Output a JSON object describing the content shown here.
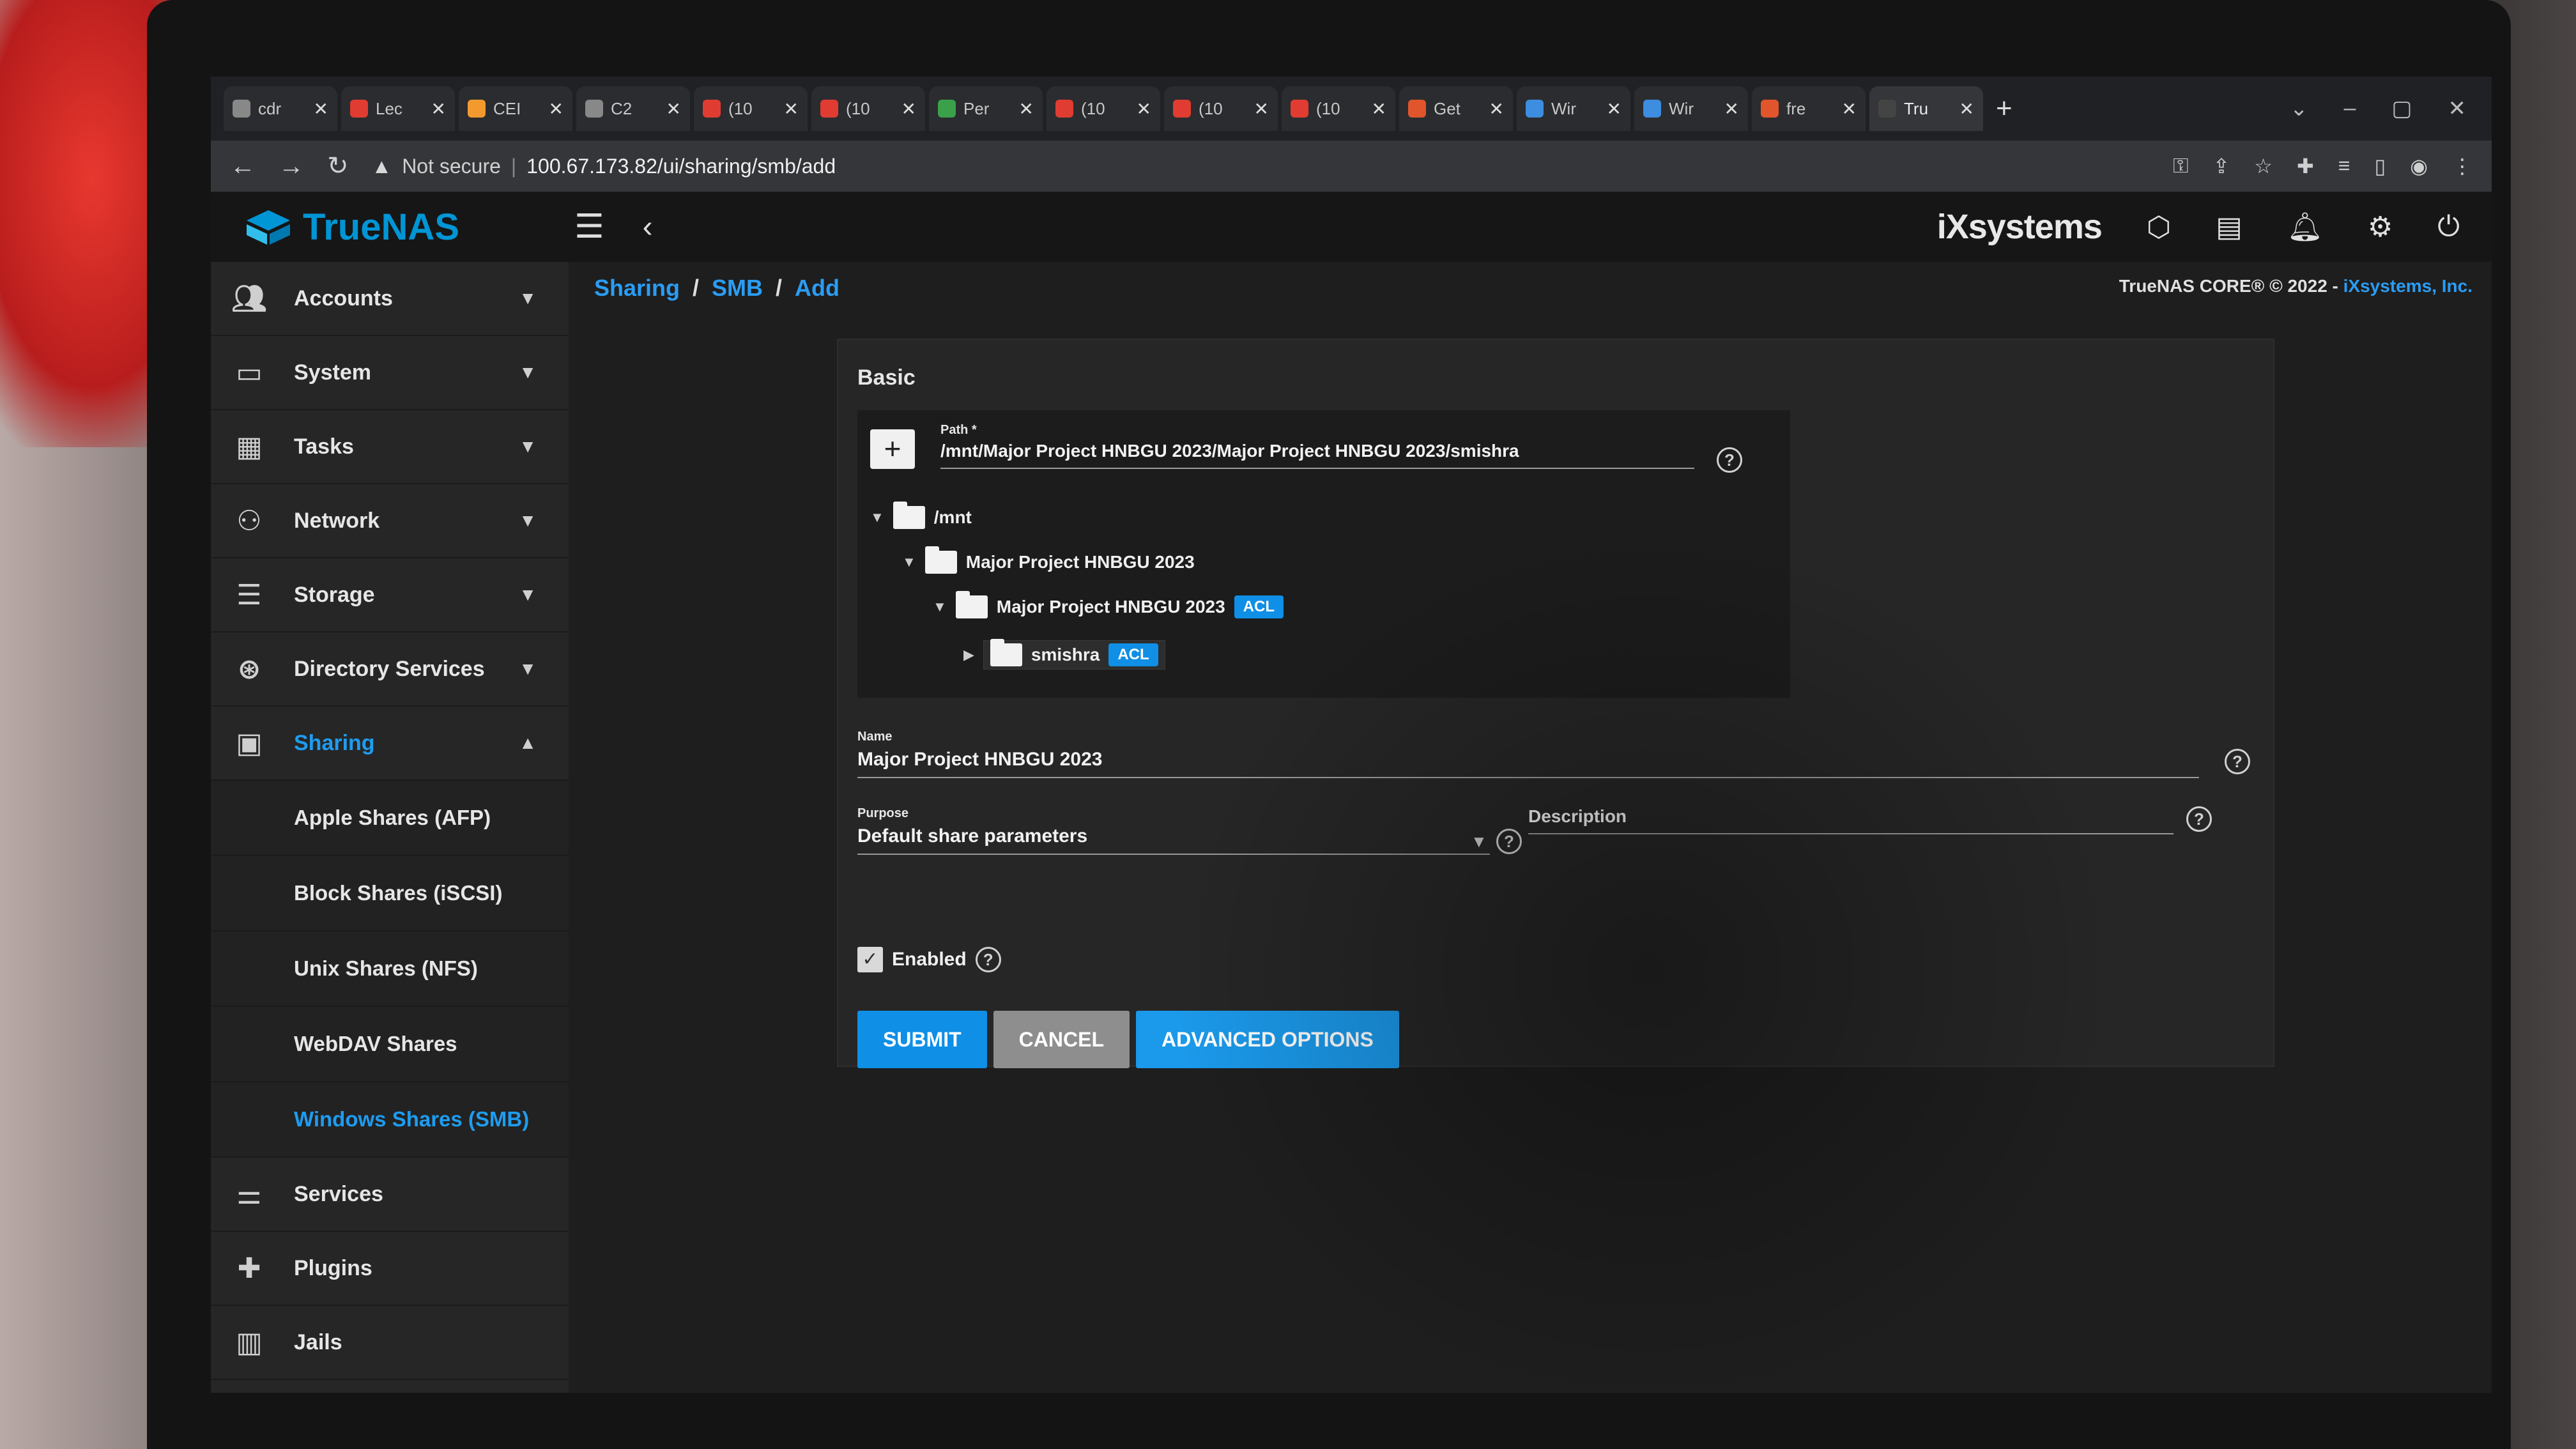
{
  "browser": {
    "tabs": [
      {
        "label": "cdr",
        "color": "#888888"
      },
      {
        "label": "Lec",
        "color": "#e03c31"
      },
      {
        "label": "CEI",
        "color": "#f29a2e"
      },
      {
        "label": "C2",
        "color": "#888888"
      },
      {
        "label": "(10",
        "color": "#e03c31"
      },
      {
        "label": "(10",
        "color": "#e03c31"
      },
      {
        "label": "Per",
        "color": "#3aa14a"
      },
      {
        "label": "(10",
        "color": "#e03c31"
      },
      {
        "label": "(10",
        "color": "#e03c31"
      },
      {
        "label": "(10",
        "color": "#e03c31"
      },
      {
        "label": "Get",
        "color": "#e0552b"
      },
      {
        "label": "Wir",
        "color": "#3d8de0"
      },
      {
        "label": "Wir",
        "color": "#3d8de0"
      },
      {
        "label": "fre",
        "color": "#e0552b"
      },
      {
        "label": "Tru",
        "color": "#444444"
      }
    ],
    "security": "Not secure",
    "url": "100.67.173.82/ui/sharing/smb/add"
  },
  "app": {
    "brand": "TrueNAS",
    "vendor": "iXsystems",
    "copyright_prefix": "TrueNAS CORE® © 2022 - ",
    "copyright_link": "iXsystems, Inc."
  },
  "sidebar": {
    "items": [
      {
        "label": "Accounts",
        "icon": "accounts-icon"
      },
      {
        "label": "System",
        "icon": "system-icon"
      },
      {
        "label": "Tasks",
        "icon": "tasks-icon"
      },
      {
        "label": "Network",
        "icon": "network-icon"
      },
      {
        "label": "Storage",
        "icon": "storage-icon"
      },
      {
        "label": "Directory Services",
        "icon": "directory-services-icon"
      },
      {
        "label": "Sharing",
        "icon": "sharing-icon"
      }
    ],
    "sharing_sub": [
      "Apple Shares (AFP)",
      "Block Shares (iSCSI)",
      "Unix Shares (NFS)",
      "WebDAV Shares",
      "Windows Shares (SMB)"
    ],
    "bottom": [
      {
        "label": "Services",
        "icon": "services-icon"
      },
      {
        "label": "Plugins",
        "icon": "plugins-icon"
      },
      {
        "label": "Jails",
        "icon": "jails-icon"
      }
    ]
  },
  "breadcrumb": [
    "Sharing",
    "SMB",
    "Add"
  ],
  "form": {
    "section": "Basic",
    "path_label": "Path *",
    "path_value": "/mnt/Major Project HNBGU 2023/Major Project HNBGU 2023/smishra",
    "tree": [
      {
        "label": "/mnt",
        "acl": ""
      },
      {
        "label": "Major Project HNBGU 2023",
        "acl": ""
      },
      {
        "label": "Major Project HNBGU 2023",
        "acl": "ACL"
      },
      {
        "label": "smishra",
        "acl": "ACL"
      }
    ],
    "name_label": "Name",
    "name_value": "Major Project HNBGU 2023",
    "purpose_label": "Purpose",
    "purpose_value": "Default share parameters",
    "description_label": "Description",
    "enabled_label": "Enabled",
    "submit": "SUBMIT",
    "cancel": "CANCEL",
    "advanced": "ADVANCED OPTIONS"
  },
  "colors": {
    "accent": "#0f8fe6",
    "brand": "#0095d5"
  }
}
